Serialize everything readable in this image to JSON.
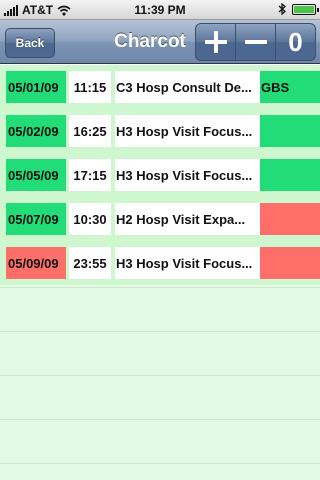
{
  "status_bar": {
    "carrier": "AT&T",
    "time": "11:39 PM"
  },
  "nav": {
    "back_label": "Back",
    "title": "Charcot",
    "tools": {
      "zero_label": "0"
    }
  },
  "colors": {
    "green": "#22dd77",
    "red": "#ff6f6a",
    "white": "#ffffff"
  },
  "rows": [
    {
      "date": "05/01/09",
      "time": "11:15",
      "description": "C3 Hosp Consult De...",
      "status": "GBS",
      "date_color": "green",
      "status_color": "green"
    },
    {
      "date": "05/02/09",
      "time": "16:25",
      "description": "H3 Hosp Visit Focus...",
      "status": "",
      "date_color": "green",
      "status_color": "green"
    },
    {
      "date": "05/05/09",
      "time": "17:15",
      "description": "H3 Hosp Visit Focus...",
      "status": "",
      "date_color": "green",
      "status_color": "green"
    },
    {
      "date": "05/07/09",
      "time": "10:30",
      "description": "H2 Hosp Visit Expa...",
      "status": "",
      "date_color": "green",
      "status_color": "red"
    },
    {
      "date": "05/09/09",
      "time": "23:55",
      "description": "H3 Hosp Visit Focus...",
      "status": "",
      "date_color": "red",
      "status_color": "red"
    }
  ]
}
